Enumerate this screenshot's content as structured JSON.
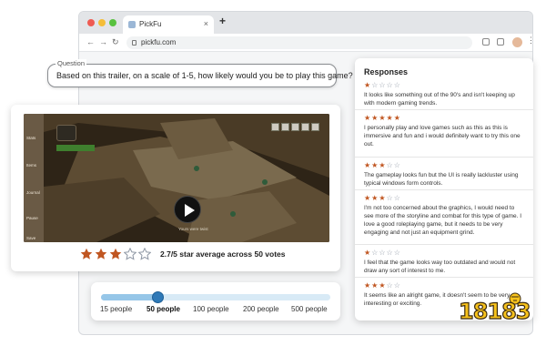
{
  "browser": {
    "tab_title": "PickFu",
    "url": "pickfu.com"
  },
  "question": {
    "label": "Question",
    "text": "Based on this trailer, on a scale of 1-5, how likely would you be to play this game?"
  },
  "video": {
    "side_menu": [
      "Stats",
      "Items",
      "Journal",
      "Pause",
      "Save"
    ],
    "caption": "Yours were twist"
  },
  "rating": {
    "stars_filled": 3,
    "stars_total": 5,
    "average": 2.7,
    "summary": "2.7/5 star average across 50 votes"
  },
  "audience": {
    "options": [
      "15 people",
      "50 people",
      "100 people",
      "200 people",
      "500 people"
    ],
    "selected": "50 people",
    "selected_index": 1,
    "slider_fraction": 0.25
  },
  "responses": {
    "title": "Responses",
    "items": [
      {
        "stars": 1,
        "text": "It looks like something out of the 90's and isn't keeping up with modern gaming trends."
      },
      {
        "stars": 5,
        "text": "I personally play and love games such as this as this is immersive and fun and i would definitely want to try this one out."
      },
      {
        "stars": 3,
        "text": "The gameplay looks fun but the UI is really lackluster using typical windows form controls."
      },
      {
        "stars": 3,
        "text": "I'm not too concerned about the graphics, I would need to see more of the storyline and combat for this type of game. I love a good roleplaying game, but it needs to be very engaging and not just an equipment grind."
      },
      {
        "stars": 1,
        "text": "I feel that the game looks way too outdated and would not draw any sort of interest to me."
      },
      {
        "stars": 3,
        "text": "It seems like an alright game, it doesn't seem to be very interesting or exciting."
      }
    ]
  },
  "colors": {
    "star_filled": "#c05621",
    "star_empty": "#8d96a3",
    "slider_knob": "#2f79b7"
  },
  "watermark": {
    "text": "18183"
  }
}
